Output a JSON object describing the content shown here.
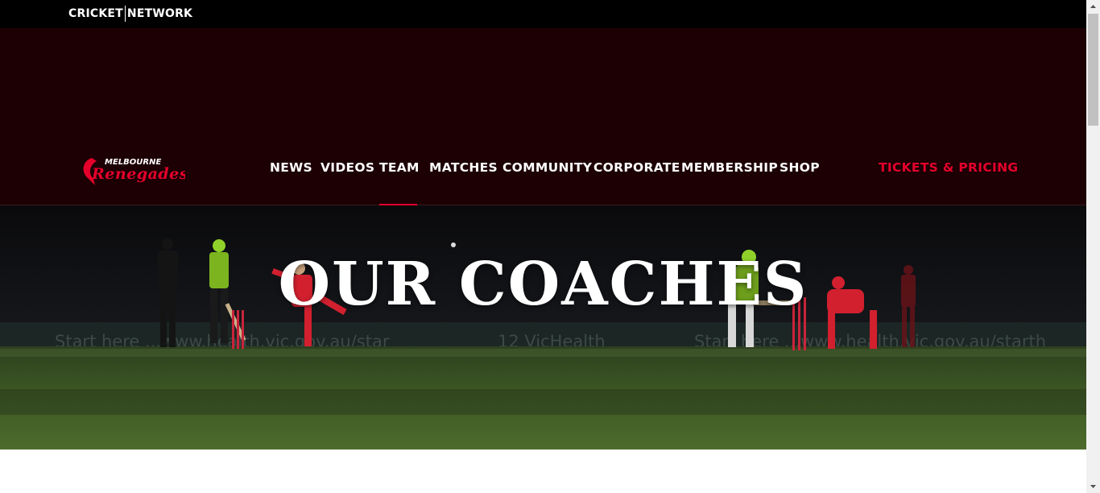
{
  "network": {
    "word1": "CRICKET",
    "word2": "NETWORK"
  },
  "brand": {
    "line1": "MELBOURNE",
    "line2": "Renegades"
  },
  "nav": {
    "items": [
      {
        "label": "NEWS"
      },
      {
        "label": "VIDEOS"
      },
      {
        "label": "TEAM",
        "active": true
      },
      {
        "label": "MATCHES"
      },
      {
        "label": "COMMUNITY"
      },
      {
        "label": "CORPORATE"
      },
      {
        "label": "MEMBERSHIP"
      },
      {
        "label": "SHOP"
      }
    ],
    "tickets": "TICKETS & PRICING"
  },
  "hero": {
    "title": "OUR COACHES",
    "signage_left": "Start here ...www.health.vic.gov.au/star",
    "signage_mid": "12 VicHealth",
    "signage_right": "Start here ...www.health.vic.gov.au/starth"
  },
  "colors": {
    "accent": "#e4002b",
    "header_bg": "#1c0004",
    "topbar": "#000000"
  },
  "icons": {
    "scroll_up": "triangle-up",
    "scroll_down": "triangle-down"
  }
}
